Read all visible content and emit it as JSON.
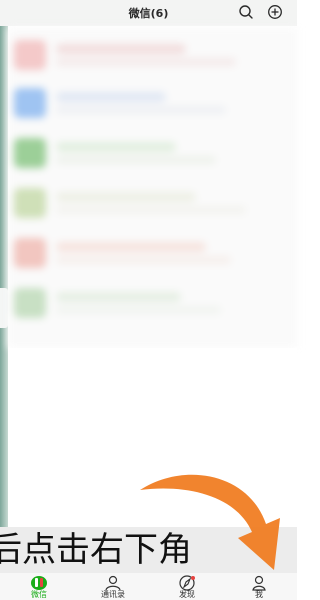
{
  "header": {
    "title": "微信(6)",
    "search_icon": "search-icon",
    "add_icon": "plus-circle-icon"
  },
  "caption": {
    "text": "后点击右下角"
  },
  "tabbar": {
    "tabs": [
      {
        "label": "微信",
        "icon": "chat-bubble-icon",
        "active": true
      },
      {
        "label": "通讯录",
        "icon": "contacts-icon",
        "active": false
      },
      {
        "label": "发现",
        "icon": "compass-icon",
        "active": false
      },
      {
        "label": "我",
        "icon": "person-icon",
        "active": false
      }
    ]
  },
  "colors": {
    "accent": "#1aad19",
    "arrow": "#f07a1c",
    "badge": "#e64340"
  }
}
